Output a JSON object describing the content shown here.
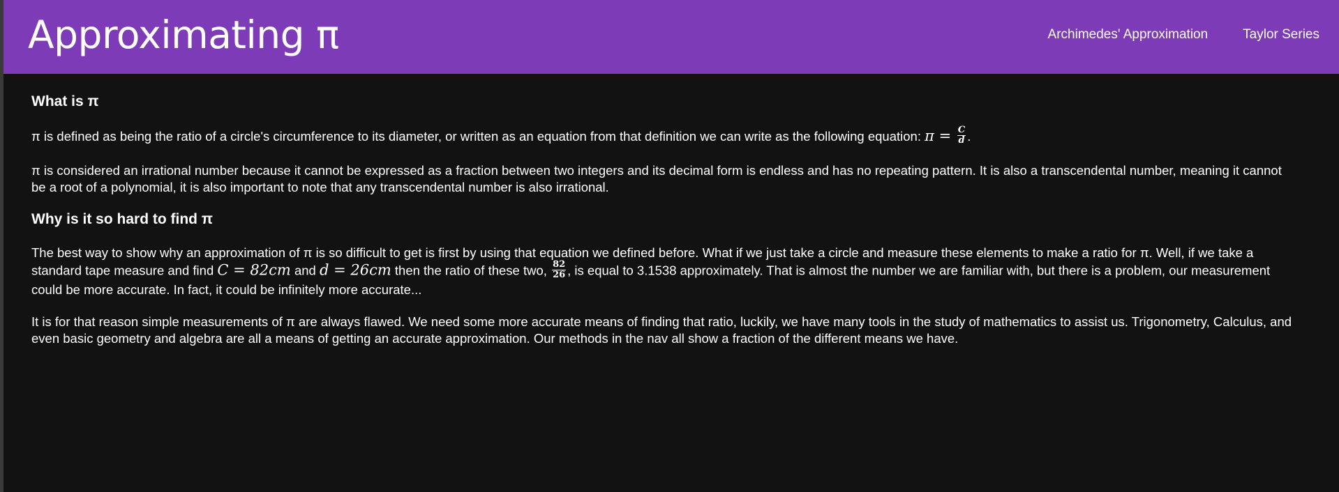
{
  "header": {
    "title": "Approximating π",
    "nav": [
      {
        "label": "Archimedes' Approximation"
      },
      {
        "label": "Taylor Series"
      }
    ]
  },
  "main": {
    "section1": {
      "heading": "What is π",
      "p1_text": "π is defined as being the ratio of a circle's circumference to its diameter, or written as an equation from that definition we can write as the following equation:",
      "p1_math_lhs": "π",
      "p1_math_eq": "=",
      "p1_frac_num": "C",
      "p1_frac_den": "d",
      "p1_end": ".",
      "p2_text": "π is considered an irrational number because it cannot be expressed as a fraction between two integers and its decimal form is endless and has no repeating pattern. It is also a transcendental number, meaning it cannot be a root of a polynomial, it is also important to note that any transcendental number is also irrational."
    },
    "section2": {
      "heading": "Why is it so hard to find π",
      "p3_a": "The best way to show why an approximation of π is so difficult to get is first by using that equation we defined before. What if we just take a circle and measure these elements to make a ratio for π. Well, if we take a standard tape measure and find",
      "p3_math_c": "C = 82cm",
      "p3_b": "and",
      "p3_math_d": "d = 26cm",
      "p3_c": "then the ratio of these two,",
      "p3_frac_num": "82",
      "p3_frac_den": "26",
      "p3_d": ", is equal to 3.1538 approximately. That is almost the number we are familiar with, but there is a problem, our measurement could be more accurate. In fact, it could be infinitely more accurate...",
      "p4_text": "It is for that reason simple measurements of π are always flawed. We need some more accurate means of finding that ratio, luckily, we have many tools in the study of mathematics to assist us. Trigonometry, Calculus, and even basic geometry and algebra are all a means of getting an accurate approximation. Our methods in the nav all show a fraction of the different means we have."
    }
  },
  "colors": {
    "header_bg": "#7e3bb8",
    "page_bg": "#121212",
    "text": "#ffffff"
  }
}
